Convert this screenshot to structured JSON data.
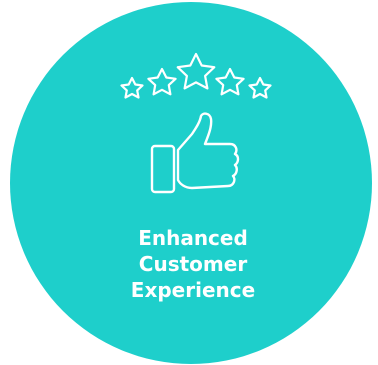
{
  "badge": {
    "colors": {
      "circle": "#1ECFCB",
      "foreground": "#FFFFFF"
    },
    "icons": {
      "stars": "five-stars-outline-icon",
      "thumb": "thumbs-up-outline-icon"
    },
    "label_lines": [
      "Enhanced",
      "Customer",
      "Experience"
    ]
  }
}
